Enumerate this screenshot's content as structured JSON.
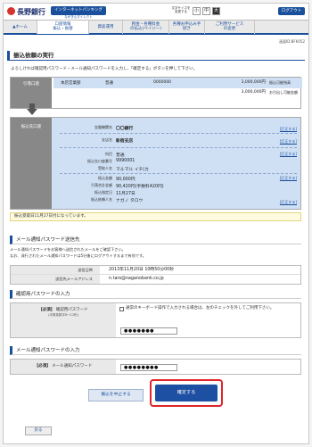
{
  "header": {
    "bank_name": "長野銀行",
    "ib_title": "インターネットバンキング",
    "ib_sub": "ながぎんダイレクト",
    "fontsize_label": "文字サイズを変更する",
    "fontsize_small": "小",
    "fontsize_mid": "中",
    "fontsize_large": "大",
    "logout": "ログアウト"
  },
  "nav": {
    "home": "▲ホーム",
    "items": [
      {
        "line1": "口座情報",
        "line2": "振込・振替"
      },
      {
        "line1": "資産運用",
        "line2": ""
      },
      {
        "line1": "税金・各種料金",
        "line2": "の払込(ペイジー)"
      },
      {
        "line1": "各種お申込み手",
        "line2": "続き"
      },
      {
        "line1": "ご利用サービス",
        "line2": "の変更"
      }
    ]
  },
  "screen_id": "画面ID:BFK052",
  "title": "振込依頼の実行",
  "intro": "よろしければ確認用パスワード・メール通知パスワードを入力し、「確定する」ボタンを押して下さい。",
  "from": {
    "label": "引落口座",
    "branch": "本店営業部",
    "type": "普通",
    "number": "0000000",
    "balance_value": "3,000,000円",
    "balance_label": "振込可能残高",
    "available_value": "3,000,000円",
    "available_label": "お引出し可能金額"
  },
  "to": {
    "label": "振込先口座",
    "rows": [
      {
        "k": "金融機関名",
        "v": "〇〇銀行"
      },
      {
        "k": "支店名",
        "v": "新宿支店"
      },
      {
        "k": "科目",
        "v": "普通"
      },
      {
        "k": "振込先口座番号",
        "v": "9990001"
      },
      {
        "k": "受取人名",
        "v": "マルマル イチ(カ"
      },
      {
        "k": "振込金額",
        "v": "90,000円"
      },
      {
        "k": "引落合計金額",
        "v": "90,420円(手数料420円)"
      },
      {
        "k": "振込指定日",
        "v": "11月27日"
      },
      {
        "k": "振込依頼人名",
        "v": "ナガノ タロウ"
      }
    ],
    "edit_label": "[訂正する]"
  },
  "notice": "振込受取日11月27日付になっています。",
  "mail_section": {
    "title": "メール通知パスワード送信先",
    "note1": "メール通知パスワードをお客様へ送信されたメールをご確認下さい。",
    "note2": "なお、発行されたメール通知パスワードは5分後にログアウトするまで有効です。",
    "sent_time_label": "送信日時",
    "sent_time_value": "2013年11月20日 10時50分00秒",
    "address_label": "送信先メールアドレス",
    "address_value": "n.taro@naganobank.co.jp"
  },
  "confirm_pw_section": {
    "title": "確認用パスワードの入力",
    "label": "確認用パスワード",
    "required": "【必須】",
    "sub": "(半角英数字8〜12桁)",
    "check_text": "通常のキーボード操作で入力される場合は、左のチェックを外してご利用下さい。",
    "value": "●●●●●●●"
  },
  "mail_pw_section": {
    "title": "メール通知パスワードの入力",
    "required": "【必須】",
    "label": "メール通知パスワード",
    "value": "●●●●●●●●"
  },
  "buttons": {
    "cancel": "振込を中止する",
    "confirm": "確定する",
    "back": "戻る"
  }
}
